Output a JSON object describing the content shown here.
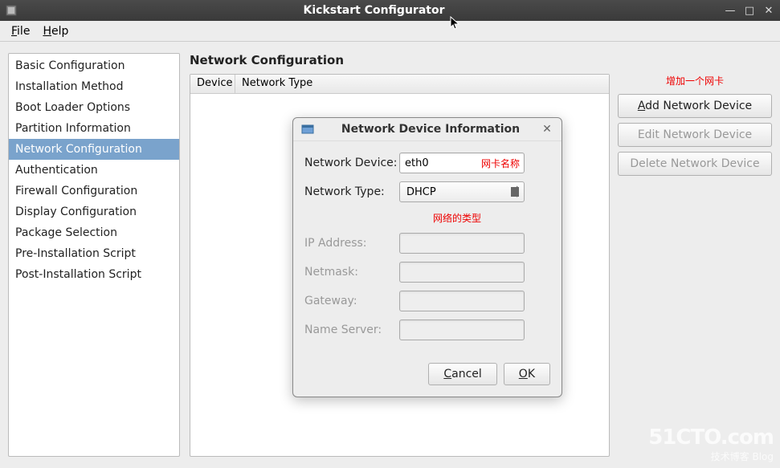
{
  "window": {
    "title": "Kickstart Configurator"
  },
  "menubar": {
    "file": "File",
    "help": "Help"
  },
  "sidebar": {
    "items": [
      {
        "label": "Basic Configuration"
      },
      {
        "label": "Installation Method"
      },
      {
        "label": "Boot Loader Options"
      },
      {
        "label": "Partition Information"
      },
      {
        "label": "Network Configuration"
      },
      {
        "label": "Authentication"
      },
      {
        "label": "Firewall Configuration"
      },
      {
        "label": "Display Configuration"
      },
      {
        "label": "Package Selection"
      },
      {
        "label": "Pre-Installation Script"
      },
      {
        "label": "Post-Installation Script"
      }
    ],
    "selected_index": 4
  },
  "main": {
    "title": "Network Configuration",
    "table": {
      "columns": [
        "Device",
        "Network Type"
      ]
    },
    "buttons": {
      "add_annotation": "增加一个网卡",
      "add": "Add Network Device",
      "edit": "Edit Network Device",
      "delete": "Delete Network Device"
    }
  },
  "dialog": {
    "title": "Network Device Information",
    "fields": {
      "device_label": "Network Device:",
      "device_value": "eth0",
      "device_annotation": "网卡名称",
      "type_label": "Network Type:",
      "type_value": "DHCP",
      "type_annotation": "网络的类型",
      "ip_label": "IP Address:",
      "netmask_label": "Netmask:",
      "gateway_label": "Gateway:",
      "nameserver_label": "Name Server:"
    },
    "buttons": {
      "cancel": "Cancel",
      "ok": "OK"
    }
  },
  "watermark": {
    "main": "51CTO.com",
    "sub": "技术博客    Blog"
  }
}
